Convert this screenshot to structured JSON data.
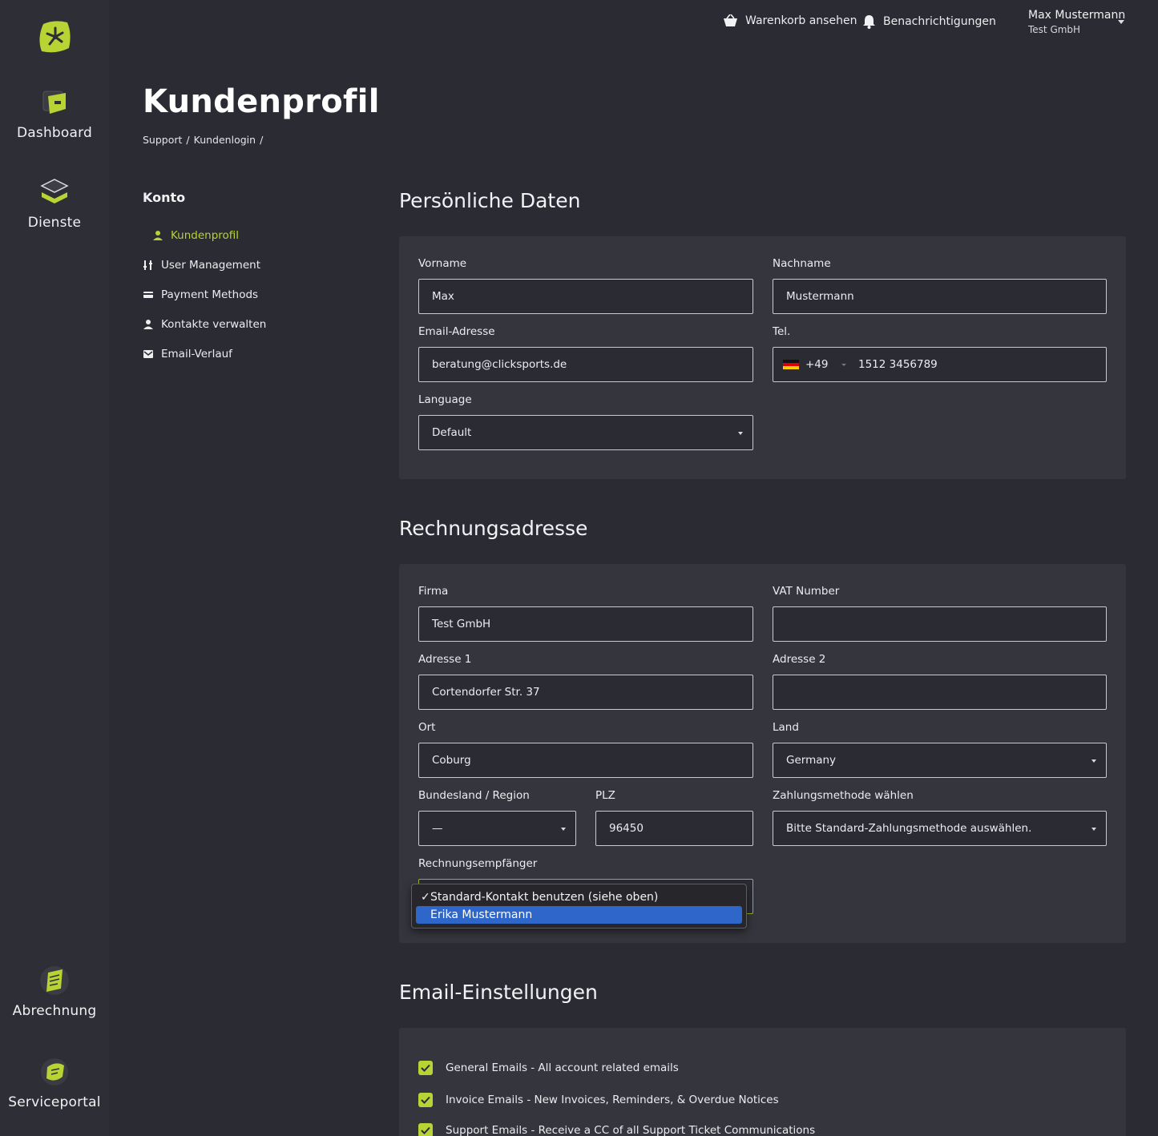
{
  "rail": {
    "items": [
      {
        "label": "Dashboard",
        "icon": "dashboard-icon"
      },
      {
        "label": "Dienste",
        "icon": "services-icon"
      },
      {
        "label": "Abrechnung",
        "icon": "billing-icon"
      },
      {
        "label": "Serviceportal",
        "icon": "serviceportal-icon"
      }
    ]
  },
  "header": {
    "cart_label": "Warenkorb ansehen",
    "notifications_label": "Benachrichtigungen",
    "user_name": "Max Mustermann",
    "user_company": "Test GmbH"
  },
  "page": {
    "title": "Kundenprofil",
    "breadcrumb": [
      "Support",
      "/",
      "Kundenlogin",
      "/"
    ]
  },
  "side_menu": {
    "heading": "Konto",
    "items": [
      {
        "label": "Kundenprofil",
        "icon": "user-icon",
        "active": true
      },
      {
        "label": "User Management",
        "icon": "sliders-icon"
      },
      {
        "label": "Payment Methods",
        "icon": "credit-card-icon"
      },
      {
        "label": "Kontakte verwalten",
        "icon": "contact-icon"
      },
      {
        "label": "Email-Verlauf",
        "icon": "envelope-icon"
      }
    ]
  },
  "personal": {
    "title": "Persönliche Daten",
    "first_name": {
      "label": "Vorname",
      "value": "Max"
    },
    "last_name": {
      "label": "Nachname",
      "value": "Mustermann"
    },
    "email": {
      "label": "Email-Adresse",
      "value": "beratung@clicksports.de"
    },
    "phone": {
      "label": "Tel.",
      "prefix": "+49",
      "value": "1512 3456789"
    },
    "language": {
      "label": "Language",
      "value": "Default"
    }
  },
  "billing": {
    "title": "Rechnungsadresse",
    "company": {
      "label": "Firma",
      "value": "Test GmbH"
    },
    "vat": {
      "label": "VAT Number",
      "value": ""
    },
    "address1": {
      "label": "Adresse 1",
      "value": "Cortendorfer Str. 37"
    },
    "address2": {
      "label": "Adresse 2",
      "value": ""
    },
    "city": {
      "label": "Ort",
      "value": "Coburg"
    },
    "country": {
      "label": "Land",
      "value": "Germany"
    },
    "state": {
      "label": "Bundesland / Region",
      "value": "—"
    },
    "zip": {
      "label": "PLZ",
      "value": "96450"
    },
    "payment": {
      "label": "Zahlungsmethode wählen",
      "value": "Bitte Standard-Zahlungsmethode auswählen."
    },
    "recipient": {
      "label": "Rechnungsempfänger",
      "options": [
        {
          "label": "Standard-Kontakt benutzen (siehe oben)",
          "checked": true
        },
        {
          "label": "Erika Mustermann",
          "highlighted": true
        }
      ]
    }
  },
  "email_settings": {
    "title": "Email-Einstellungen",
    "items": [
      {
        "label": "General Emails - All account related emails",
        "checked": true
      },
      {
        "label": "Invoice Emails - New Invoices, Reminders, & Overdue Notices",
        "checked": true
      },
      {
        "label": "Support Emails - Receive a CC of all Support Ticket Communications",
        "checked": true
      }
    ]
  },
  "colors": {
    "accent": "#b7d334",
    "background": "#2b2b33",
    "card": "#35353d",
    "highlight": "#2f66c9"
  }
}
